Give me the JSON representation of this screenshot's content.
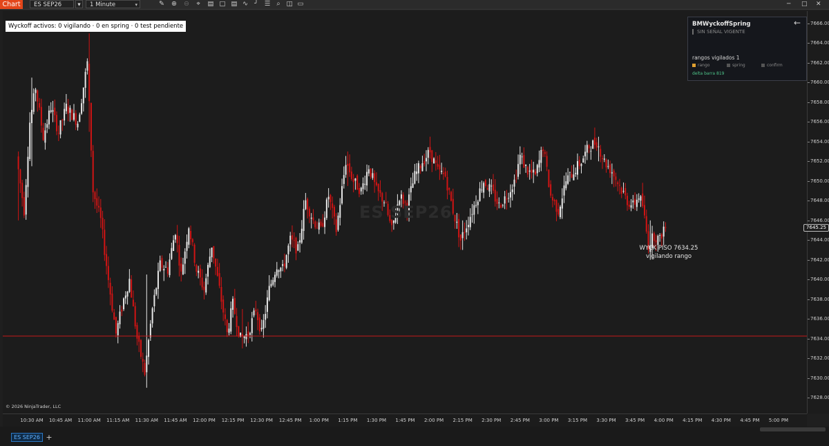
{
  "toolbar": {
    "app_tab": "Chart",
    "instrument": "ES SEP26",
    "interval": "1 Minute",
    "icons": [
      "pencil-icon",
      "zoom-in-icon",
      "zoom-out-icon",
      "crosshair-icon",
      "data-box-icon",
      "bar-style-icon",
      "strategies-icon",
      "indicators-icon",
      "draw-tools-icon",
      "properties-icon",
      "attach-icon",
      "chart-trader-icon",
      "orders-icon"
    ]
  },
  "status": "Wyckoff activos: 0 vigilando · 0 en spring · 0 test pendiente",
  "watermark": "ES SEP26",
  "copyright": "© 2026 NinjaTrader, LLC",
  "price_axis": [
    "7666.00",
    "7664.00",
    "7662.00",
    "7660.00",
    "7658.00",
    "7656.00",
    "7654.00",
    "7652.00",
    "7650.00",
    "7648.00",
    "7646.00",
    "7644.00",
    "7642.00",
    "7640.00",
    "7638.00",
    "7636.00",
    "7634.00",
    "7632.00",
    "7630.00",
    "7628.00"
  ],
  "current_price": "7645.25",
  "time_axis": [
    "10:30 AM",
    "10:45 AM",
    "11:00 AM",
    "11:15 AM",
    "11:30 AM",
    "11:45 AM",
    "12:00 PM",
    "12:15 PM",
    "12:30 PM",
    "12:45 PM",
    "1:00 PM",
    "1:15 PM",
    "1:30 PM",
    "1:45 PM",
    "2:00 PM",
    "2:15 PM",
    "2:30 PM",
    "2:45 PM",
    "3:00 PM",
    "3:15 PM",
    "3:30 PM",
    "3:45 PM",
    "4:00 PM",
    "4:15 PM",
    "4:30 PM",
    "4:45 PM",
    "5:00 PM"
  ],
  "annotation": {
    "line1": "WYCK PISO 7634.25",
    "line2": "vigilando rango"
  },
  "level_line": {
    "price": 7634.25,
    "color": "#c61a1a"
  },
  "panel": {
    "title": "BMWyckoffSpring",
    "subtitle": "SIN SEÑAL VIGENTE",
    "ranges": "rangos vigilados  1",
    "legend": [
      {
        "label": "rango",
        "color": "#e0a030"
      },
      {
        "label": "spring",
        "color": "#555555"
      },
      {
        "label": "confirm",
        "color": "#555555"
      }
    ],
    "delta": "delta barra  819"
  },
  "colors": {
    "up": "#e8e8e8",
    "down": "#d11414",
    "background": "#1c1c1c",
    "accent": "#e3461a"
  },
  "bottom": {
    "tab": "ES SEP26",
    "add": "+"
  },
  "chart_data": {
    "type": "candlestick",
    "symbol": "ES SEP26",
    "interval": "1 Minute",
    "ylim": [
      7627,
      7667
    ],
    "x_range": [
      "10:23 AM",
      "5:06 PM"
    ],
    "path": [
      [
        "10:23 AM",
        7652.5
      ],
      [
        "10:27 AM",
        7647.0
      ],
      [
        "10:30 AM",
        7656.0
      ],
      [
        "10:33 AM",
        7659.5
      ],
      [
        "10:37 AM",
        7654.5
      ],
      [
        "10:41 AM",
        7657.5
      ],
      [
        "10:45 AM",
        7655.0
      ],
      [
        "10:49 AM",
        7657.5
      ],
      [
        "10:55 AM",
        7656.0
      ],
      [
        "11:00 AM",
        7662.0
      ],
      [
        "11:03 AM",
        7649.0
      ],
      [
        "11:07 AM",
        7646.0
      ],
      [
        "11:11 AM",
        7640.0
      ],
      [
        "11:15 AM",
        7634.5
      ],
      [
        "11:19 AM",
        7638.0
      ],
      [
        "11:22 AM",
        7640.0
      ],
      [
        "11:26 AM",
        7634.0
      ],
      [
        "11:30 AM",
        7630.5
      ],
      [
        "11:34 AM",
        7637.0
      ],
      [
        "11:38 AM",
        7641.5
      ],
      [
        "11:42 AM",
        7641.0
      ],
      [
        "11:46 AM",
        7645.0
      ],
      [
        "11:49 AM",
        7640.5
      ],
      [
        "11:53 AM",
        7645.5
      ],
      [
        "11:57 AM",
        7641.0
      ],
      [
        "12:01 PM",
        7639.0
      ],
      [
        "12:05 PM",
        7643.5
      ],
      [
        "12:09 PM",
        7639.0
      ],
      [
        "12:13 PM",
        7634.5
      ],
      [
        "12:16 PM",
        7637.5
      ],
      [
        "12:20 PM",
        7634.0
      ],
      [
        "12:24 PM",
        7634.5
      ],
      [
        "12:28 PM",
        7637.0
      ],
      [
        "12:31 PM",
        7634.5
      ],
      [
        "12:35 PM",
        7639.0
      ],
      [
        "12:39 PM",
        7641.5
      ],
      [
        "12:42 PM",
        7641.0
      ],
      [
        "12:46 PM",
        7644.0
      ],
      [
        "12:50 PM",
        7643.0
      ],
      [
        "12:54 PM",
        7648.0
      ],
      [
        "12:58 PM",
        7646.0
      ],
      [
        "1:02 PM",
        7645.0
      ],
      [
        "1:06 PM",
        7648.5
      ],
      [
        "1:10 PM",
        7645.0
      ],
      [
        "1:15 PM",
        7652.0
      ],
      [
        "1:19 PM",
        7650.0
      ],
      [
        "1:23 PM",
        7649.0
      ],
      [
        "1:27 PM",
        7651.5
      ],
      [
        "1:31 PM",
        7649.0
      ],
      [
        "1:35 PM",
        7648.0
      ],
      [
        "1:39 PM",
        7645.0
      ],
      [
        "1:43 PM",
        7648.5
      ],
      [
        "1:47 PM",
        7647.5
      ],
      [
        "1:51 PM",
        7650.5
      ],
      [
        "1:55 PM",
        7652.0
      ],
      [
        "1:59 PM",
        7653.0
      ],
      [
        "2:03 PM",
        7651.0
      ],
      [
        "2:07 PM",
        7650.5
      ],
      [
        "2:11 PM",
        7647.0
      ],
      [
        "2:15 PM",
        7644.0
      ],
      [
        "2:19 PM",
        7646.0
      ],
      [
        "2:23 PM",
        7648.0
      ],
      [
        "2:27 PM",
        7650.0
      ],
      [
        "2:31 PM",
        7649.0
      ],
      [
        "2:35 PM",
        7647.5
      ],
      [
        "2:39 PM",
        7648.5
      ],
      [
        "2:43 PM",
        7650.0
      ],
      [
        "2:46 PM",
        7652.5
      ],
      [
        "2:50 PM",
        7651.0
      ],
      [
        "2:54 PM",
        7650.5
      ],
      [
        "2:58 PM",
        7653.5
      ],
      [
        "3:02 PM",
        7648.5
      ],
      [
        "3:06 PM",
        7647.0
      ],
      [
        "3:10 PM",
        7650.0
      ],
      [
        "3:14 PM",
        7651.0
      ],
      [
        "3:18 PM",
        7652.0
      ],
      [
        "3:22 PM",
        7653.5
      ],
      [
        "3:26 PM",
        7654.0
      ],
      [
        "3:30 PM",
        7652.0
      ],
      [
        "3:34 PM",
        7651.0
      ],
      [
        "3:38 PM",
        7649.5
      ],
      [
        "3:42 PM",
        7648.0
      ],
      [
        "3:45 PM",
        7647.5
      ],
      [
        "3:48 PM",
        7648.5
      ],
      [
        "3:50 PM",
        7647.5
      ],
      [
        "3:53 PM",
        7643.5
      ],
      [
        "3:56 PM",
        7644.5
      ],
      [
        "3:59 PM",
        7644.0
      ],
      [
        "4:01 PM",
        7645.25
      ]
    ],
    "extremes": [
      [
        "10:23 AM",
        7653.0,
        7646.0
      ],
      [
        "10:30 AM",
        7660.5,
        7651.5
      ],
      [
        "11:00 AM",
        7665.0,
        7655.0
      ],
      [
        "11:30 AM",
        7640.5,
        7629.0
      ],
      [
        "12:20 PM",
        7637.0,
        7633.0
      ],
      [
        "1:15 PM",
        7653.0,
        7649.5
      ],
      [
        "2:15 PM",
        7646.0,
        7643.0
      ],
      [
        "3:26 PM",
        7654.5,
        7652.0
      ],
      [
        "3:53 PM",
        7646.0,
        7642.0
      ]
    ],
    "last_price": 7645.25,
    "level": 7634.25
  }
}
